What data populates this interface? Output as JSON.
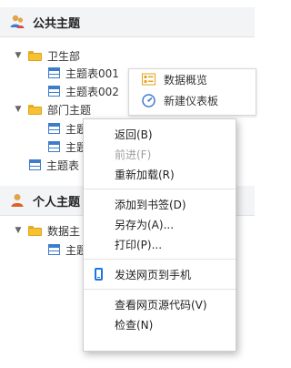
{
  "public_section": {
    "title": "公共主题",
    "items": [
      {
        "label": "卫生部"
      },
      {
        "label": "主题表001"
      },
      {
        "label": "主题表002"
      },
      {
        "label": "部门主题"
      },
      {
        "label": "主题"
      },
      {
        "label": "主题"
      },
      {
        "label": "主题表"
      }
    ]
  },
  "personal_section": {
    "title": "个人主题",
    "items": [
      {
        "label": "数据主"
      },
      {
        "label": "主题"
      }
    ]
  },
  "flyout_menu": {
    "items": [
      {
        "label": "数据概览",
        "icon": "data-overview-icon"
      },
      {
        "label": "新建仪表板",
        "icon": "dashboard-gauge-icon"
      }
    ]
  },
  "context_menu": {
    "back": "返回(B)",
    "forward": "前进(F)",
    "reload": "重新加载(R)",
    "bookmark": "添加到书签(D)",
    "save_as": "另存为(A)...",
    "print": "打印(P)...",
    "send_to_phone": "发送网页到手机",
    "view_source": "查看网页源代码(V)",
    "inspect": "检查(N)"
  },
  "colors": {
    "folder": "#f6c232",
    "table_icon": "#3d7ccc",
    "phone_icon": "#1a73e8",
    "disabled_text": "#a0a0a0"
  }
}
